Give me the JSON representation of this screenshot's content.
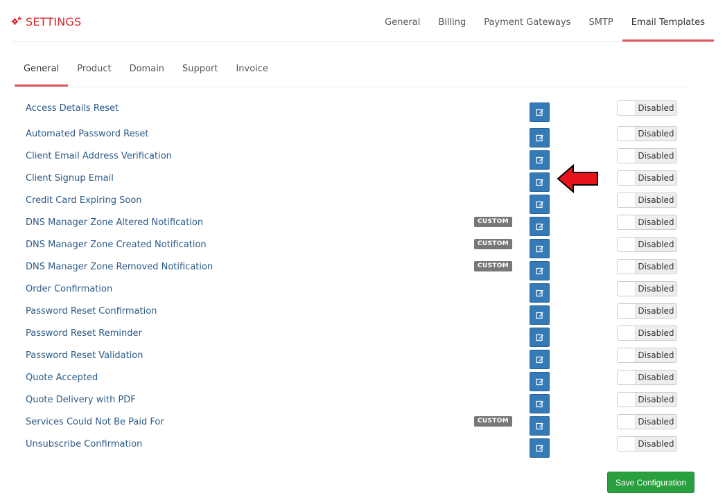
{
  "header": {
    "title": "SETTINGS",
    "icon": "gears-icon",
    "accent_color": "#d9262b"
  },
  "top_tabs": [
    "General",
    "Billing",
    "Payment Gateways",
    "SMTP",
    "Email Templates"
  ],
  "top_tabs_active": "Email Templates",
  "sub_tabs": [
    "General",
    "Product",
    "Domain",
    "Support",
    "Invoice"
  ],
  "sub_tabs_active": "General",
  "templates": [
    {
      "name": "Access Details Reset",
      "custom": false,
      "status": "Disabled"
    },
    {
      "name": "Automated Password Reset",
      "custom": false,
      "status": "Disabled"
    },
    {
      "name": "Client Email Address Verification",
      "custom": false,
      "status": "Disabled"
    },
    {
      "name": "Client Signup Email",
      "custom": false,
      "status": "Disabled"
    },
    {
      "name": "Credit Card Expiring Soon",
      "custom": false,
      "status": "Disabled"
    },
    {
      "name": "DNS Manager Zone Altered Notification",
      "custom": true,
      "status": "Disabled"
    },
    {
      "name": "DNS Manager Zone Created Notification",
      "custom": true,
      "status": "Disabled"
    },
    {
      "name": "DNS Manager Zone Removed Notification",
      "custom": true,
      "status": "Disabled"
    },
    {
      "name": "Order Confirmation",
      "custom": false,
      "status": "Disabled"
    },
    {
      "name": "Password Reset Confirmation",
      "custom": false,
      "status": "Disabled"
    },
    {
      "name": "Password Reset Reminder",
      "custom": false,
      "status": "Disabled"
    },
    {
      "name": "Password Reset Validation",
      "custom": false,
      "status": "Disabled"
    },
    {
      "name": "Quote Accepted",
      "custom": false,
      "status": "Disabled"
    },
    {
      "name": "Quote Delivery with PDF",
      "custom": false,
      "status": "Disabled"
    },
    {
      "name": "Services Could Not Be Paid For",
      "custom": true,
      "status": "Disabled"
    },
    {
      "name": "Unsubscribe Confirmation",
      "custom": false,
      "status": "Disabled"
    }
  ],
  "custom_badge_label": "CUSTOM",
  "edit_icon": "edit-icon",
  "save_button_label": "Save Configuration",
  "colors": {
    "link": "#2b5a86",
    "edit_button": "#337ab7",
    "save_button": "#2a9f3e",
    "active_tab_underline": "#e0545b",
    "arrow": "#e8141c"
  }
}
